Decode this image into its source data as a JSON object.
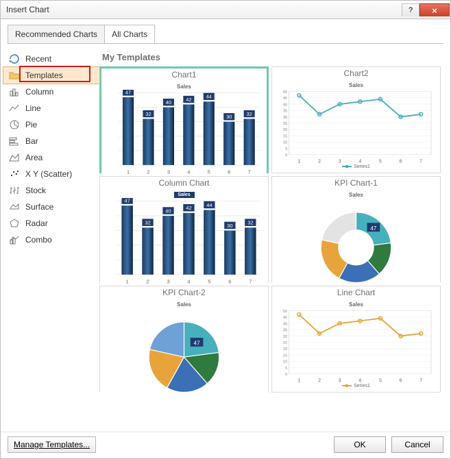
{
  "window": {
    "title": "Insert Chart"
  },
  "tabs": {
    "recommended": "Recommended Charts",
    "all": "All Charts"
  },
  "sidebar": {
    "items": [
      {
        "label": "Recent"
      },
      {
        "label": "Templates"
      },
      {
        "label": "Column"
      },
      {
        "label": "Line"
      },
      {
        "label": "Pie"
      },
      {
        "label": "Bar"
      },
      {
        "label": "Area"
      },
      {
        "label": "X Y (Scatter)"
      },
      {
        "label": "Stock"
      },
      {
        "label": "Surface"
      },
      {
        "label": "Radar"
      },
      {
        "label": "Combo"
      }
    ]
  },
  "main": {
    "heading": "My Templates"
  },
  "templates": [
    {
      "caption": "Chart1",
      "plot_title": "Sales"
    },
    {
      "caption": "Chart2",
      "plot_title": "Sales",
      "legend": "Series1"
    },
    {
      "caption": "Column Chart",
      "plot_title": "Sales"
    },
    {
      "caption": "KPI Chart-1",
      "plot_title": "Sales"
    },
    {
      "caption": "KPI Chart-2",
      "plot_title": "Sales"
    },
    {
      "caption": "Line Chart",
      "plot_title": "Sales",
      "legend": "Series1"
    }
  ],
  "footer": {
    "manage": "Manage Templates...",
    "ok": "OK",
    "cancel": "Cancel"
  },
  "chart_data": [
    {
      "name": "Chart1",
      "type": "bar",
      "categories": [
        1,
        2,
        3,
        4,
        5,
        6,
        7
      ],
      "values": [
        47,
        32,
        40,
        42,
        44,
        30,
        32
      ],
      "title": "Sales",
      "ylim": [
        0,
        50
      ]
    },
    {
      "name": "Chart2",
      "type": "line",
      "x": [
        1,
        2,
        3,
        4,
        5,
        6,
        7
      ],
      "y": [
        47,
        32,
        40,
        42,
        44,
        30,
        32
      ],
      "title": "Sales",
      "ylim": [
        0,
        50
      ],
      "legend": "Series1"
    },
    {
      "name": "Column Chart",
      "type": "bar",
      "categories": [
        1,
        2,
        3,
        4,
        5,
        6,
        7
      ],
      "values": [
        47,
        32,
        40,
        42,
        44,
        30,
        32
      ],
      "title": "Sales",
      "ylim": [
        0,
        50
      ]
    },
    {
      "name": "KPI Chart-1",
      "type": "pie",
      "subtype": "doughnut",
      "title": "Sales",
      "slices": [
        {
          "value": 47,
          "color": "#46b0bd"
        },
        {
          "value": 32,
          "color": "#2e7a3f"
        },
        {
          "value": 40,
          "color": "#3b6fb6"
        },
        {
          "value": 42,
          "color": "#e8a43a"
        },
        {
          "value": 44,
          "color": "#e3e3e3"
        }
      ],
      "center_label": "47"
    },
    {
      "name": "KPI Chart-2",
      "type": "pie",
      "title": "Sales",
      "slices": [
        {
          "value": 47,
          "color": "#46b0bd"
        },
        {
          "value": 32,
          "color": "#2e7a3f"
        },
        {
          "value": 40,
          "color": "#3b6fb6"
        },
        {
          "value": 42,
          "color": "#e8a43a"
        },
        {
          "value": 44,
          "color": "#6fa0d6"
        }
      ],
      "center_label": "47"
    },
    {
      "name": "Line Chart",
      "type": "line",
      "x": [
        1,
        2,
        3,
        4,
        5,
        6,
        7
      ],
      "y": [
        47,
        32,
        40,
        42,
        44,
        30,
        32
      ],
      "title": "Sales",
      "ylim": [
        0,
        50
      ],
      "legend": "Series1",
      "color": "#e8a43a"
    }
  ]
}
